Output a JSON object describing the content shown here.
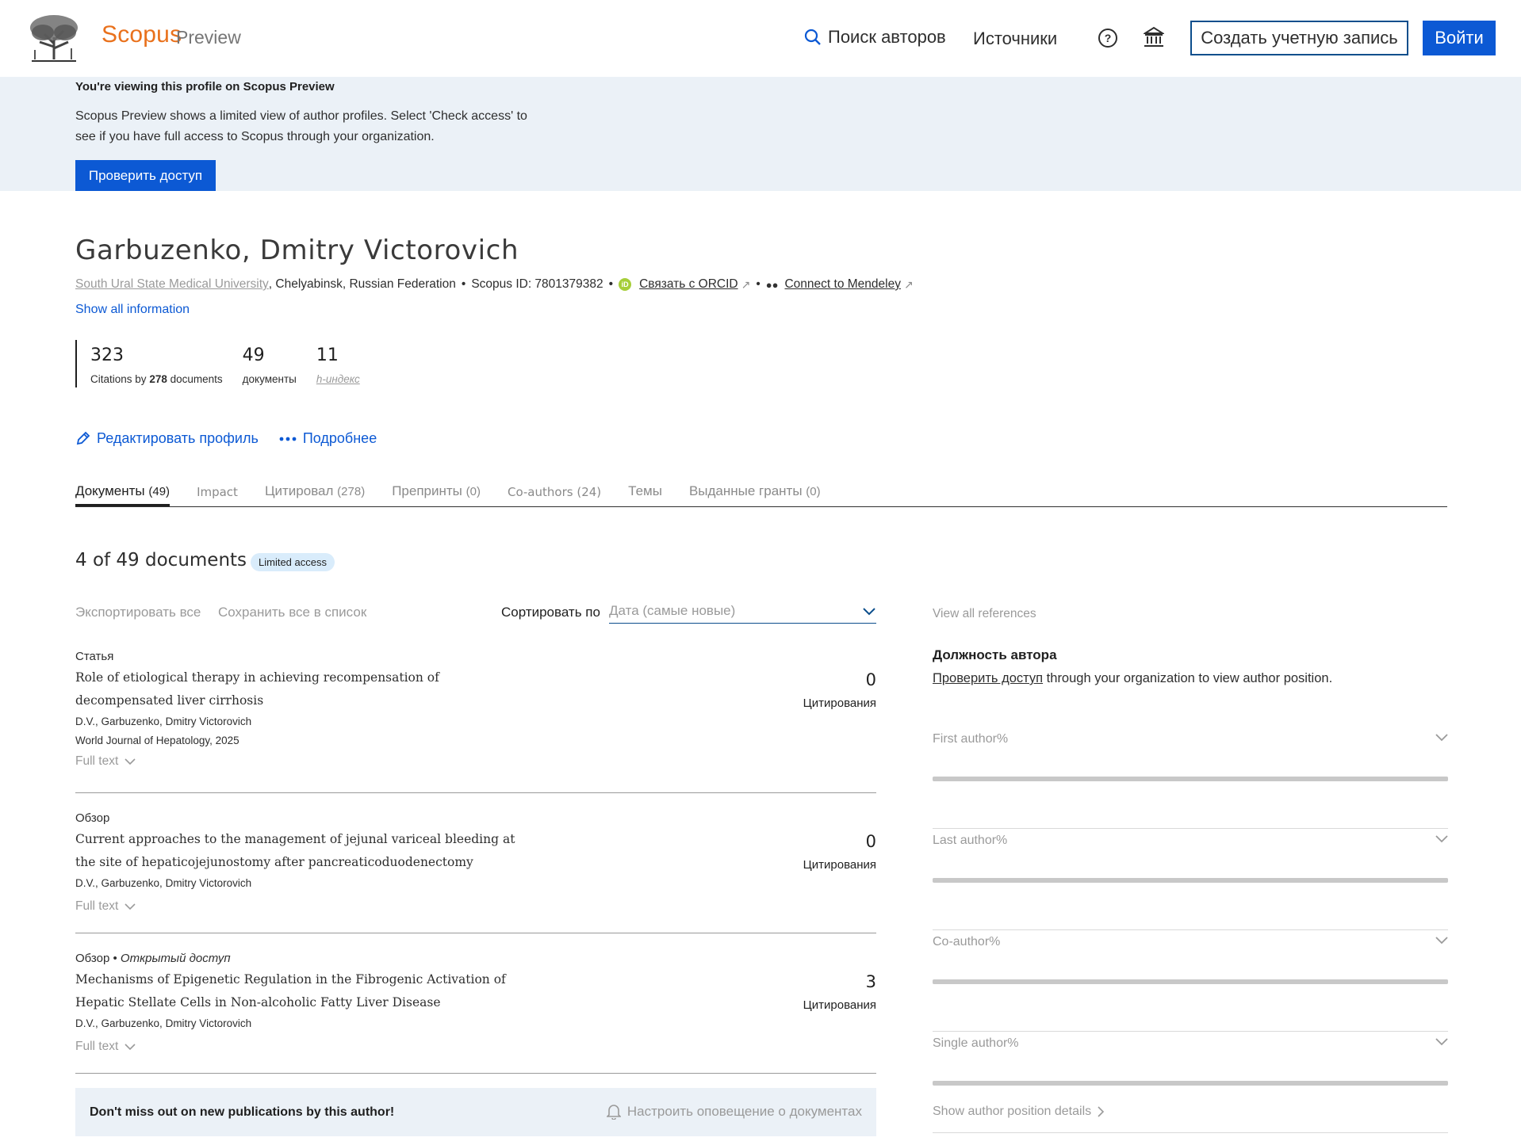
{
  "header": {
    "brand": "Scopus",
    "brand_suffix": "Preview",
    "nav_search_authors": "Поиск авторов",
    "nav_sources": "Источники",
    "create_account": "Создать учетную запись",
    "login": "Войти",
    "icons": [
      "search-icon",
      "help-icon",
      "institution-icon"
    ]
  },
  "banner": {
    "title": "You're viewing this profile on Scopus Preview",
    "text": "Scopus Preview shows a limited view of author profiles. Select 'Check access' to see if you have full access to Scopus through your organization.",
    "check_access": "Проверить доступ"
  },
  "author": {
    "name": "Garbuzenko, Dmitry Victorovich",
    "affiliation": "South Ural State Medical University",
    "location": ", Chelyabinsk, Russian Federation",
    "scopus_id": "Scopus ID: 7801379382",
    "orcid_link": "Связать с ORCID",
    "mendeley_link": "Connect to Mendeley",
    "show_all": "Show all information"
  },
  "metrics": {
    "citations": "323",
    "citations_label_prefix": "Citations by",
    "citations_docs": "278",
    "citations_label_suffix": "documents",
    "documents": "49",
    "documents_label": "документы",
    "h_index": "11",
    "h_index_label": "h-индекс"
  },
  "actions": {
    "edit_profile": "Редактировать профиль",
    "more": "Подробнее"
  },
  "tabs": [
    {
      "label": "Документы",
      "count": "(49)"
    },
    {
      "label": "Impact",
      "count": ""
    },
    {
      "label": "Цитировал",
      "count": "(278)"
    },
    {
      "label": "Препринты",
      "count": "(0)"
    },
    {
      "label": "Co-authors",
      "count": "(24)"
    },
    {
      "label": "Темы",
      "count": ""
    },
    {
      "label": "Выданные гранты",
      "count": "(0)"
    }
  ],
  "documents": {
    "title": "4 of 49 documents",
    "badge": "Limited access",
    "export_all": "Экспортировать все",
    "save_all": "Сохранить все в список",
    "sort_label": "Сортировать по",
    "sort_value": "Дата (самые новые)",
    "items": [
      {
        "type": "Статья",
        "open_access": "",
        "title": "Role of etiological therapy in achieving recompensation of decompensated liver cirrhosis",
        "authors": "D.V., Garbuzenko, Dmitry Victorovich",
        "source": "World Journal of Hepatology, 2025",
        "citations": "0",
        "citations_label": "Цитирования",
        "full_text": "Full text"
      },
      {
        "type": "Обзор",
        "open_access": "",
        "title": "Current approaches to the management of jejunal variceal bleeding at the site of hepaticojejunostomy after pancreaticoduodenectomy",
        "authors": "D.V., Garbuzenko, Dmitry Victorovich",
        "source": "",
        "citations": "0",
        "citations_label": "Цитирования",
        "full_text": "Full text"
      },
      {
        "type": "Обзор",
        "open_access": "Открытый доступ",
        "title": "Mechanisms of Epigenetic Regulation in the Fibrogenic Activation of Hepatic Stellate Cells in Non-alcoholic Fatty Liver Disease",
        "authors": "D.V., Garbuzenko, Dmitry Victorovich",
        "source": "",
        "citations": "3",
        "citations_label": "Цитирования",
        "full_text": "Full text"
      }
    ],
    "alert_text": "Don't miss out on new publications by this author!",
    "alert_link": "Настроить оповещение о документах"
  },
  "author_position": {
    "view_refs": "View all references",
    "title": "Должность автора",
    "check_link": "Проверить доступ",
    "text": " through your organization to view author position.",
    "items": [
      {
        "label": "First author%"
      },
      {
        "label": "Last author%"
      },
      {
        "label": "Co-author%"
      },
      {
        "label": "Single author%"
      }
    ],
    "show_details": "Show author position details"
  }
}
